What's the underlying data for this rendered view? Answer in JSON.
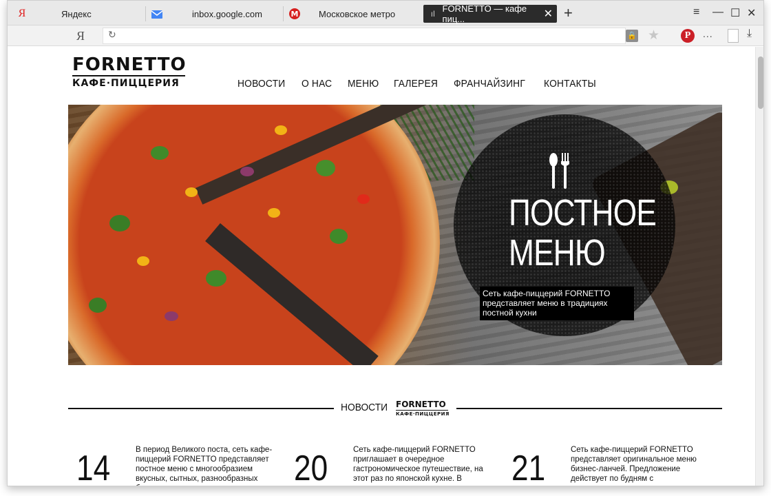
{
  "browser": {
    "tabs": [
      {
        "label": "Яндекс",
        "icon": "yandex-icon"
      },
      {
        "label": "inbox.google.com",
        "icon": "inbox-icon"
      },
      {
        "label": "Московское метро",
        "icon": "metro-icon"
      },
      {
        "label": "FORNETTO — кафе пиц...",
        "icon": "fornetto-tab-icon",
        "active": true
      }
    ],
    "new_tab": "+",
    "yandex_button": "Я",
    "address": "",
    "more": "..."
  },
  "site": {
    "logo_line1": "FORNETTO",
    "logo_line2": "КАФЕ·ПИЦЦЕРИЯ",
    "nav": [
      "НОВОСТИ",
      "О НАС",
      "МЕНЮ",
      "ГАЛЕРЕЯ",
      "ФРАНЧАЙЗИНГ",
      "КОНТАКТЫ"
    ]
  },
  "hero": {
    "title_line1": "ПОСТНОЕ",
    "title_line2": "МЕНЮ",
    "caption": "Сеть кафе-пиццерий FORNETTO представляет меню в традициях постной кухни"
  },
  "news": {
    "section_title": "НОВОСТИ",
    "items": [
      {
        "day": "14",
        "text": "В период Великого поста, сеть кафе-пиццерий FORNETTO представляет постное меню с многообразием вкусных, сытных, разнообразных блюд"
      },
      {
        "day": "20",
        "text": "Сеть кафе-пиццерий FORNETTO приглашает в очередное гастрономическое путешествие, на этот раз по японской кухне. В"
      },
      {
        "day": "21",
        "text": "Сеть кафе-пиццерий FORNETTO представляет оригинальное меню бизнес-ланчей. Предложение действует по будням с"
      }
    ]
  },
  "colors": {
    "pinterest": "#cb2027",
    "tab_active_bg": "#2b2b2b"
  }
}
